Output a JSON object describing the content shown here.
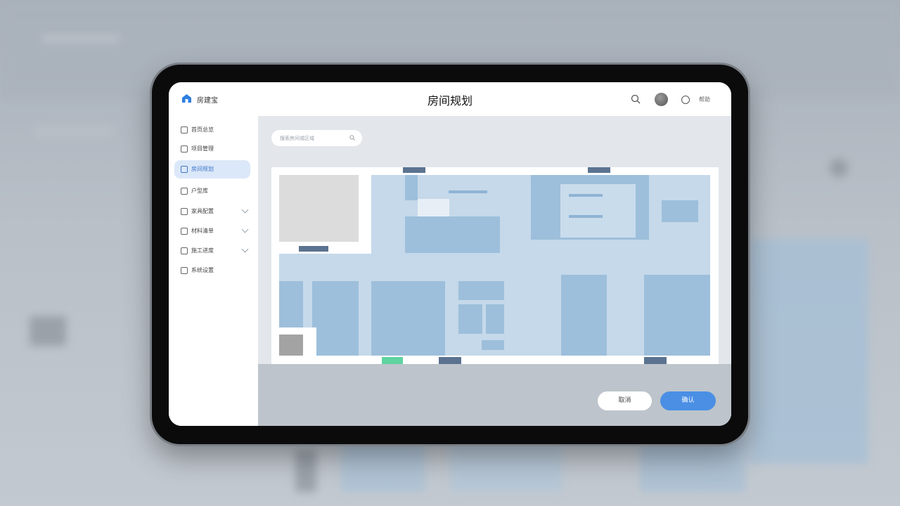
{
  "header": {
    "app_name": "房建宝",
    "title": "房间规划",
    "right_label": "帮助"
  },
  "sidebar": {
    "items": [
      {
        "label": "首页总览",
        "active": false,
        "has_chevron": false
      },
      {
        "label": "项目管理",
        "active": false,
        "has_chevron": false
      },
      {
        "label": "房间规划",
        "active": true,
        "has_chevron": false
      },
      {
        "label": "户型库",
        "active": false,
        "has_chevron": false
      },
      {
        "label": "家具配置",
        "active": false,
        "has_chevron": true
      },
      {
        "label": "材料清单",
        "active": false,
        "has_chevron": true
      },
      {
        "label": "施工进度",
        "active": false,
        "has_chevron": true
      },
      {
        "label": "系统设置",
        "active": false,
        "has_chevron": false
      }
    ]
  },
  "search": {
    "placeholder": "搜索房间或区域"
  },
  "actions": {
    "cancel_label": "取消",
    "confirm_label": "确认"
  },
  "colors": {
    "accent": "#4a8fe4",
    "active_bg": "#dbe8f9",
    "room_light": "#c5d9ea",
    "room_mid": "#9dbfdb",
    "door": "#5b7390",
    "entrance": "#5fd3a0"
  },
  "icons": {
    "logo": "house-icon",
    "search": "search-icon",
    "avatar": "avatar",
    "status": "circle-icon"
  }
}
